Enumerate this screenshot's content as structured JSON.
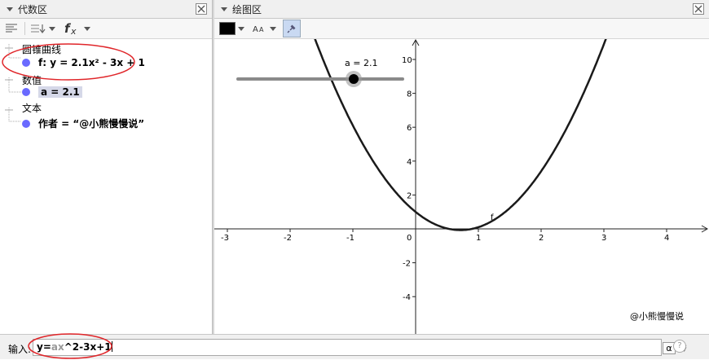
{
  "algebra": {
    "title": "代数区",
    "categories": [
      {
        "label": "圆锥曲线",
        "items": [
          "f: y = 2.1x² - 3x + 1"
        ]
      },
      {
        "label": "数值",
        "items": [
          "a = 2.1"
        ]
      },
      {
        "label": "文本",
        "items": [
          "作者 = “@小熊慢慢说”"
        ]
      }
    ]
  },
  "graphics": {
    "title": "绘图区",
    "slider_label": "a = 2.1",
    "slider_value": 2.1,
    "curve_label": "f",
    "watermark": "@小熊慢慢说",
    "x_ticks": [
      "-3",
      "-2",
      "-1",
      "0",
      "1",
      "2",
      "3",
      "4"
    ],
    "y_ticks": [
      "10",
      "8",
      "6",
      "4",
      "2",
      "-2",
      "-4"
    ]
  },
  "input": {
    "label": "输入:",
    "value_plain_1": "y=",
    "value_grey": "ax",
    "value_plain_2": "^2-3x+1",
    "alpha": "α",
    "help": "?"
  },
  "colors": {
    "annotation": "#e0262a",
    "point": "#6a6aff",
    "curve": "#1a1a1a"
  }
}
